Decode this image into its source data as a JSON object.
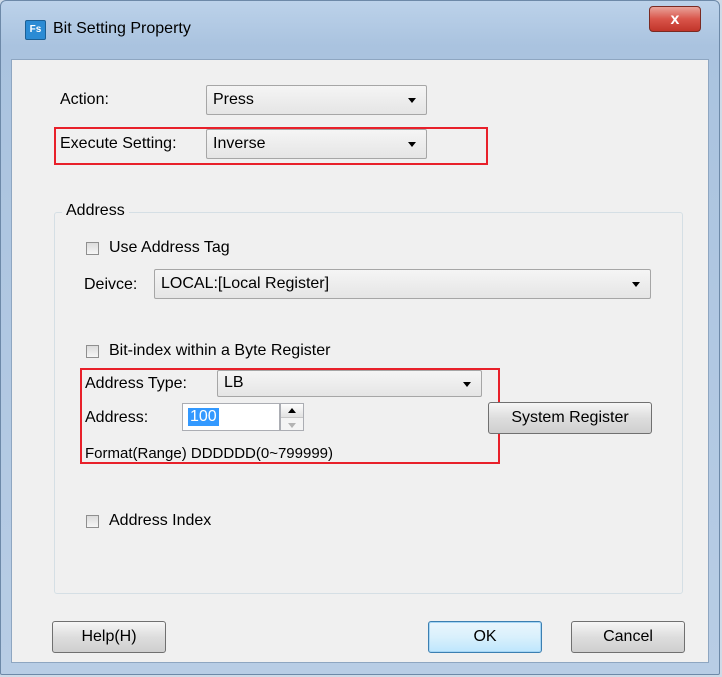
{
  "window": {
    "title": "Bit Setting Property",
    "app_icon_text": "Fs",
    "close_label": "x"
  },
  "action": {
    "label": "Action:",
    "value": "Press"
  },
  "execute": {
    "label": "Execute Setting:",
    "value": "Inverse"
  },
  "address_group": {
    "title": "Address",
    "use_tag_label": "Use Address Tag",
    "device_label": "Deivce:",
    "device_value": "LOCAL:[Local Register]",
    "bit_index_label": "Bit-index within a Byte Register",
    "type_label": "Address Type:",
    "type_value": "LB",
    "address_label": "Address:",
    "address_value": "100",
    "system_register_label": "System Register",
    "format_text": "Format(Range)  DDDDDD(0~799999)",
    "address_index_label": "Address Index"
  },
  "buttons": {
    "help": "Help(H)",
    "ok": "OK",
    "cancel": "Cancel"
  },
  "colors": {
    "highlight_box": "#e8202a",
    "selection": "#3399ff"
  }
}
